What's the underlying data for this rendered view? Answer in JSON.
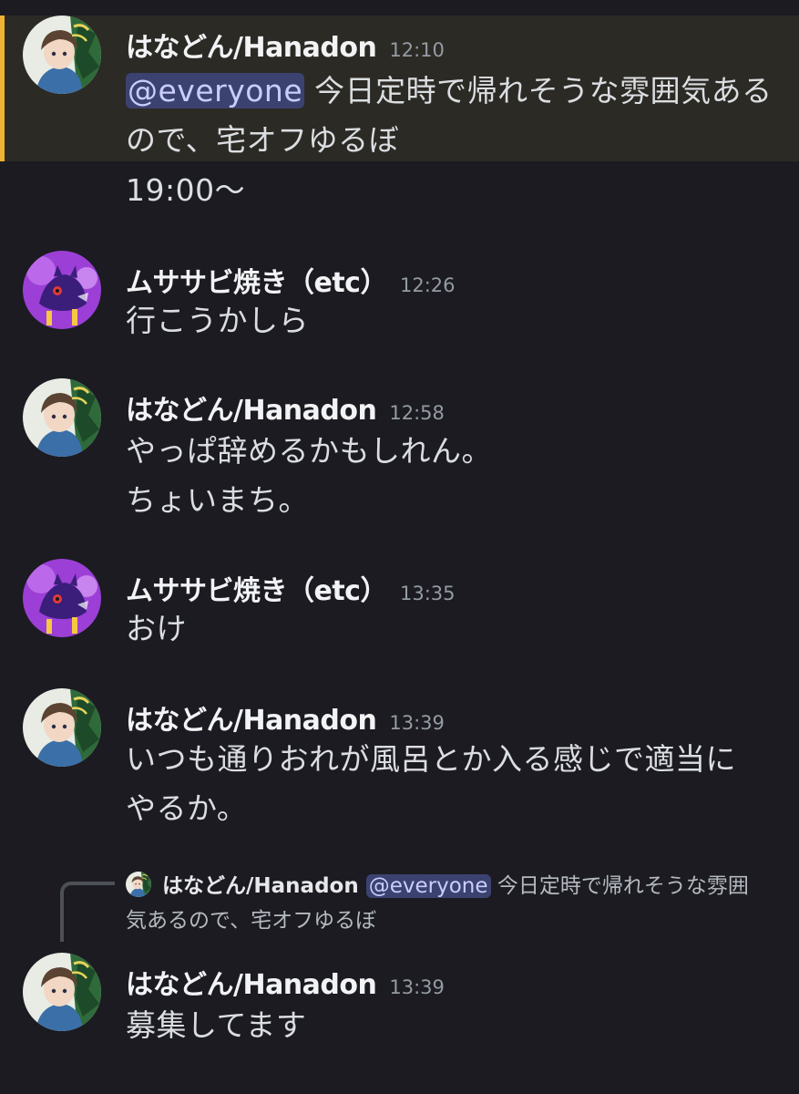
{
  "messages": [
    {
      "author": "はなどん/Hanadon",
      "time": "12:10",
      "mention": "@everyone",
      "lines": [
        "今日定時で帰れそうな雰囲気ある",
        "ので、宅オフゆるぼ"
      ]
    },
    {
      "author": "",
      "time": "",
      "lines": [
        "19:00〜"
      ]
    },
    {
      "author": "ムササビ焼き（etc）",
      "time": "12:26",
      "lines": [
        "行こうかしら"
      ]
    },
    {
      "author": "はなどん/Hanadon",
      "time": "12:58",
      "lines": [
        "やっぱ辞めるかもしれん。",
        "ちょいまち。"
      ]
    },
    {
      "author": "ムササビ焼き（etc）",
      "time": "13:35",
      "lines": [
        "おけ"
      ]
    },
    {
      "author": "はなどん/Hanadon",
      "time": "13:39",
      "lines": [
        "いつも通りおれが風呂とか入る感じで適当に",
        "やるか。"
      ]
    },
    {
      "author": "はなどん/Hanadon",
      "time": "13:39",
      "lines": [
        "募集してます"
      ],
      "reply": {
        "author": "はなどん/Hanadon",
        "mention": "@everyone",
        "text_1": "今日定時で帰れそうな雰囲",
        "text_2": "気あるので、宅オフゆるぼ"
      }
    }
  ],
  "colors": {
    "background": "#1b1b21",
    "highlight_bg": "#2c2a25",
    "highlight_bar": "#f0b232",
    "mention_bg": "#3c4270",
    "mention_text": "#c9cdfb"
  },
  "icons": {
    "hanadon_avatar": "hanadon-avatar",
    "musasabi_avatar": "musasabi-avatar"
  }
}
